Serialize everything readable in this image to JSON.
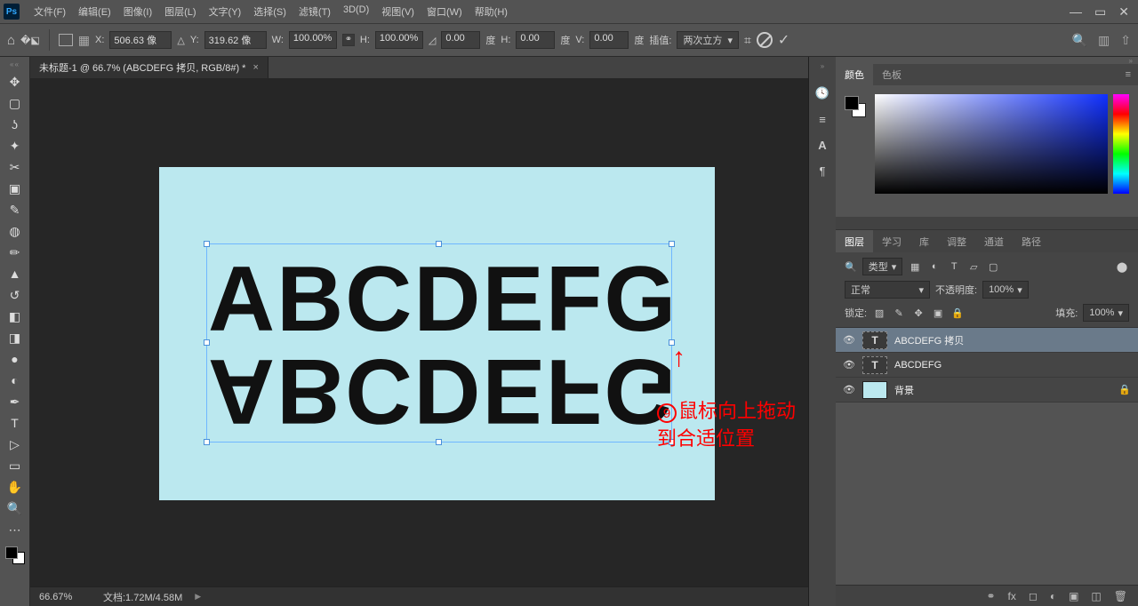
{
  "menu": [
    "文件(F)",
    "编辑(E)",
    "图像(I)",
    "图层(L)",
    "文字(Y)",
    "选择(S)",
    "滤镜(T)",
    "3D(D)",
    "视图(V)",
    "窗口(W)",
    "帮助(H)"
  ],
  "opt": {
    "x": "506.63 像",
    "y": "319.62 像",
    "w": "100.00%",
    "h": "100.00%",
    "rot": "0.00",
    "hskew": "0.00",
    "vskew": "0.00",
    "interp_label": "插值:",
    "interp_value": "两次立方",
    "deg": "度",
    "X": "X:",
    "Y": "Y:",
    "W": "W:",
    "H": "H:",
    "Hs": "H:",
    "Vs": "V:"
  },
  "doctab": "未标题-1 @ 66.7% (ABCDEFG 拷贝, RGB/8#) *",
  "canvas": {
    "text": "ABCDEFG"
  },
  "annotation": {
    "num": "9",
    "line1": "鼠标向上拖动",
    "line2": "到合适位置"
  },
  "status": {
    "zoom": "66.67%",
    "doc": "文档:1.72M/4.58M"
  },
  "color_tabs": [
    "颜色",
    "色板"
  ],
  "layer_tabs": [
    "图层",
    "学习",
    "库",
    "调整",
    "通道",
    "路径"
  ],
  "layer_controls": {
    "kind": "类型",
    "blend": "正常",
    "opacity_label": "不透明度:",
    "opacity": "100%",
    "lock_label": "锁定:",
    "fill_label": "填充:",
    "fill": "100%"
  },
  "layers": [
    {
      "name": "ABCDEFG 拷贝",
      "type": "T",
      "selected": true
    },
    {
      "name": "ABCDEFG",
      "type": "T",
      "selected": false
    },
    {
      "name": "背景",
      "type": "bg",
      "selected": false,
      "locked": true
    }
  ]
}
